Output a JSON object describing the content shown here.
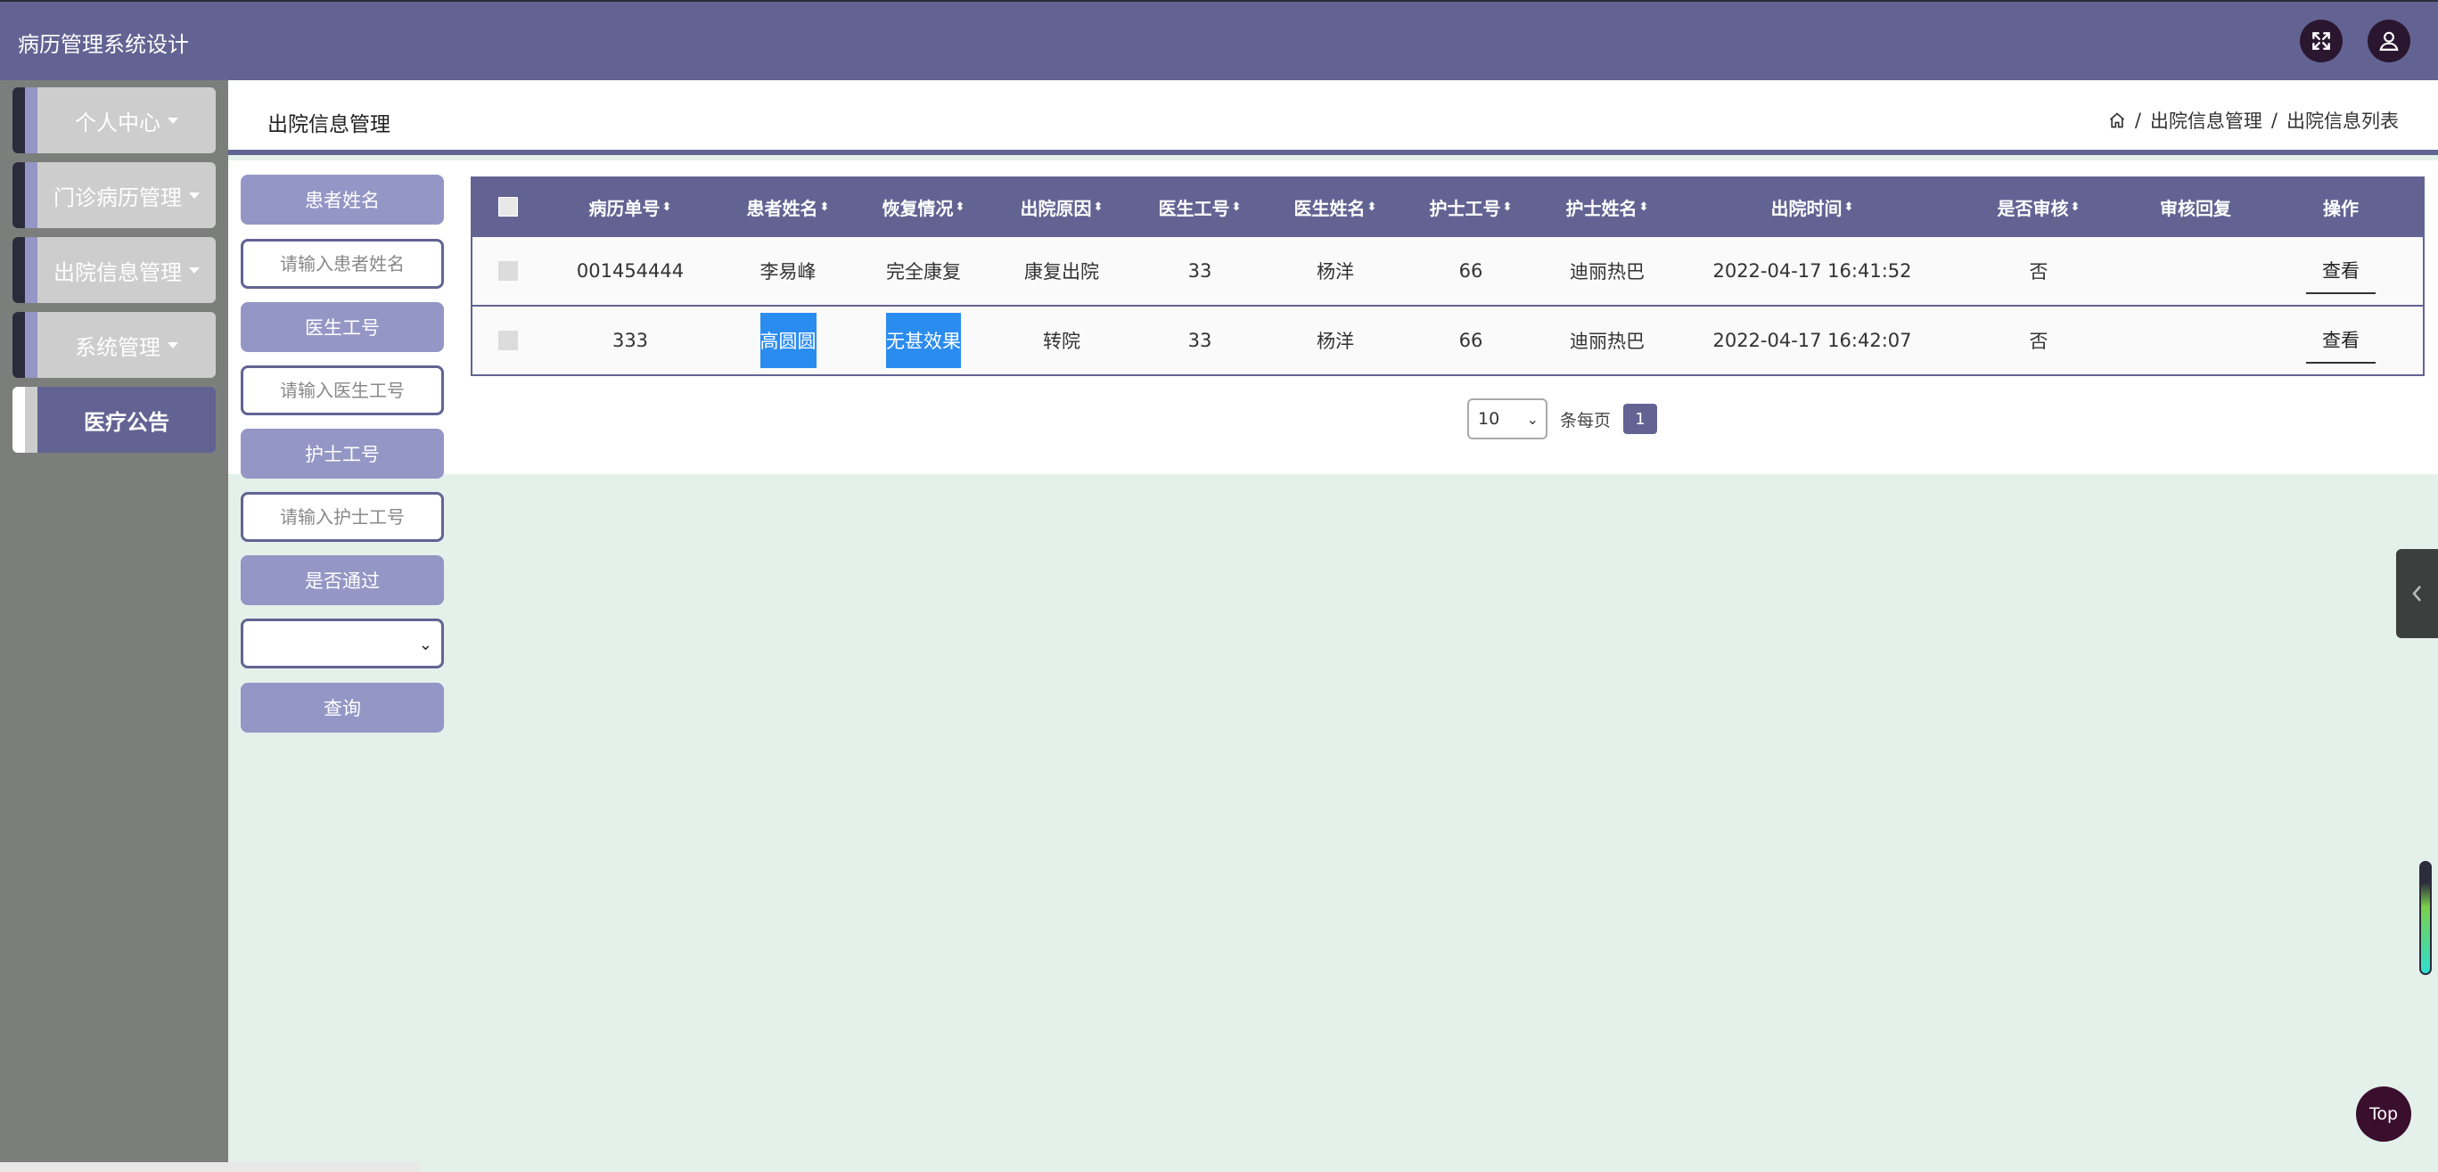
{
  "header": {
    "title": "病历管理系统设计"
  },
  "sidebar": {
    "items": [
      {
        "label": "个人中心",
        "has_caret": true
      },
      {
        "label": "门诊病历管理",
        "has_caret": true
      },
      {
        "label": "出院信息管理",
        "has_caret": true
      },
      {
        "label": "系统管理",
        "has_caret": true
      },
      {
        "label": "医疗公告",
        "has_caret": false,
        "active": true
      }
    ]
  },
  "page": {
    "title": "出院信息管理",
    "breadcrumb": [
      "出院信息管理",
      "出院信息列表"
    ],
    "breadcrumb_sep": "/"
  },
  "search": {
    "patient_name_label": "患者姓名",
    "patient_name_placeholder": "请输入患者姓名",
    "doctor_id_label": "医生工号",
    "doctor_id_placeholder": "请输入医生工号",
    "nurse_id_label": "护士工号",
    "nurse_id_placeholder": "请输入护士工号",
    "approved_label": "是否通过",
    "approved_value": "",
    "query_button": "查询"
  },
  "table": {
    "columns": [
      "病历单号",
      "患者姓名",
      "恢复情况",
      "出院原因",
      "医生工号",
      "医生姓名",
      "护士工号",
      "护士姓名",
      "出院时间",
      "是否审核",
      "审核回复",
      "操作"
    ],
    "sort_icon": "⬍",
    "rows": [
      {
        "record_no": "001454444",
        "patient": "李易峰",
        "recovery": "完全康复",
        "reason": "康复出院",
        "doctor_id": "33",
        "doctor": "杨洋",
        "nurse_id": "66",
        "nurse": "迪丽热巴",
        "discharge_time": "2022-04-17 16:41:52",
        "reviewed": "否",
        "reply": "",
        "action": "查看"
      },
      {
        "record_no": "333",
        "patient": "高圆圆",
        "recovery": "无甚效果",
        "reason": "转院",
        "doctor_id": "33",
        "doctor": "杨洋",
        "nurse_id": "66",
        "nurse": "迪丽热巴",
        "discharge_time": "2022-04-17 16:42:07",
        "reviewed": "否",
        "reply": "",
        "action": "查看"
      }
    ]
  },
  "pagination": {
    "page_size": "10",
    "per_page_text": "条每页",
    "current_page": "1"
  },
  "floating": {
    "top_label": "Top"
  },
  "colors": {
    "primary": "#636393",
    "accent_light": "#9496c5",
    "highlight": "#2b8cf0",
    "background": "#e4f1ea"
  }
}
